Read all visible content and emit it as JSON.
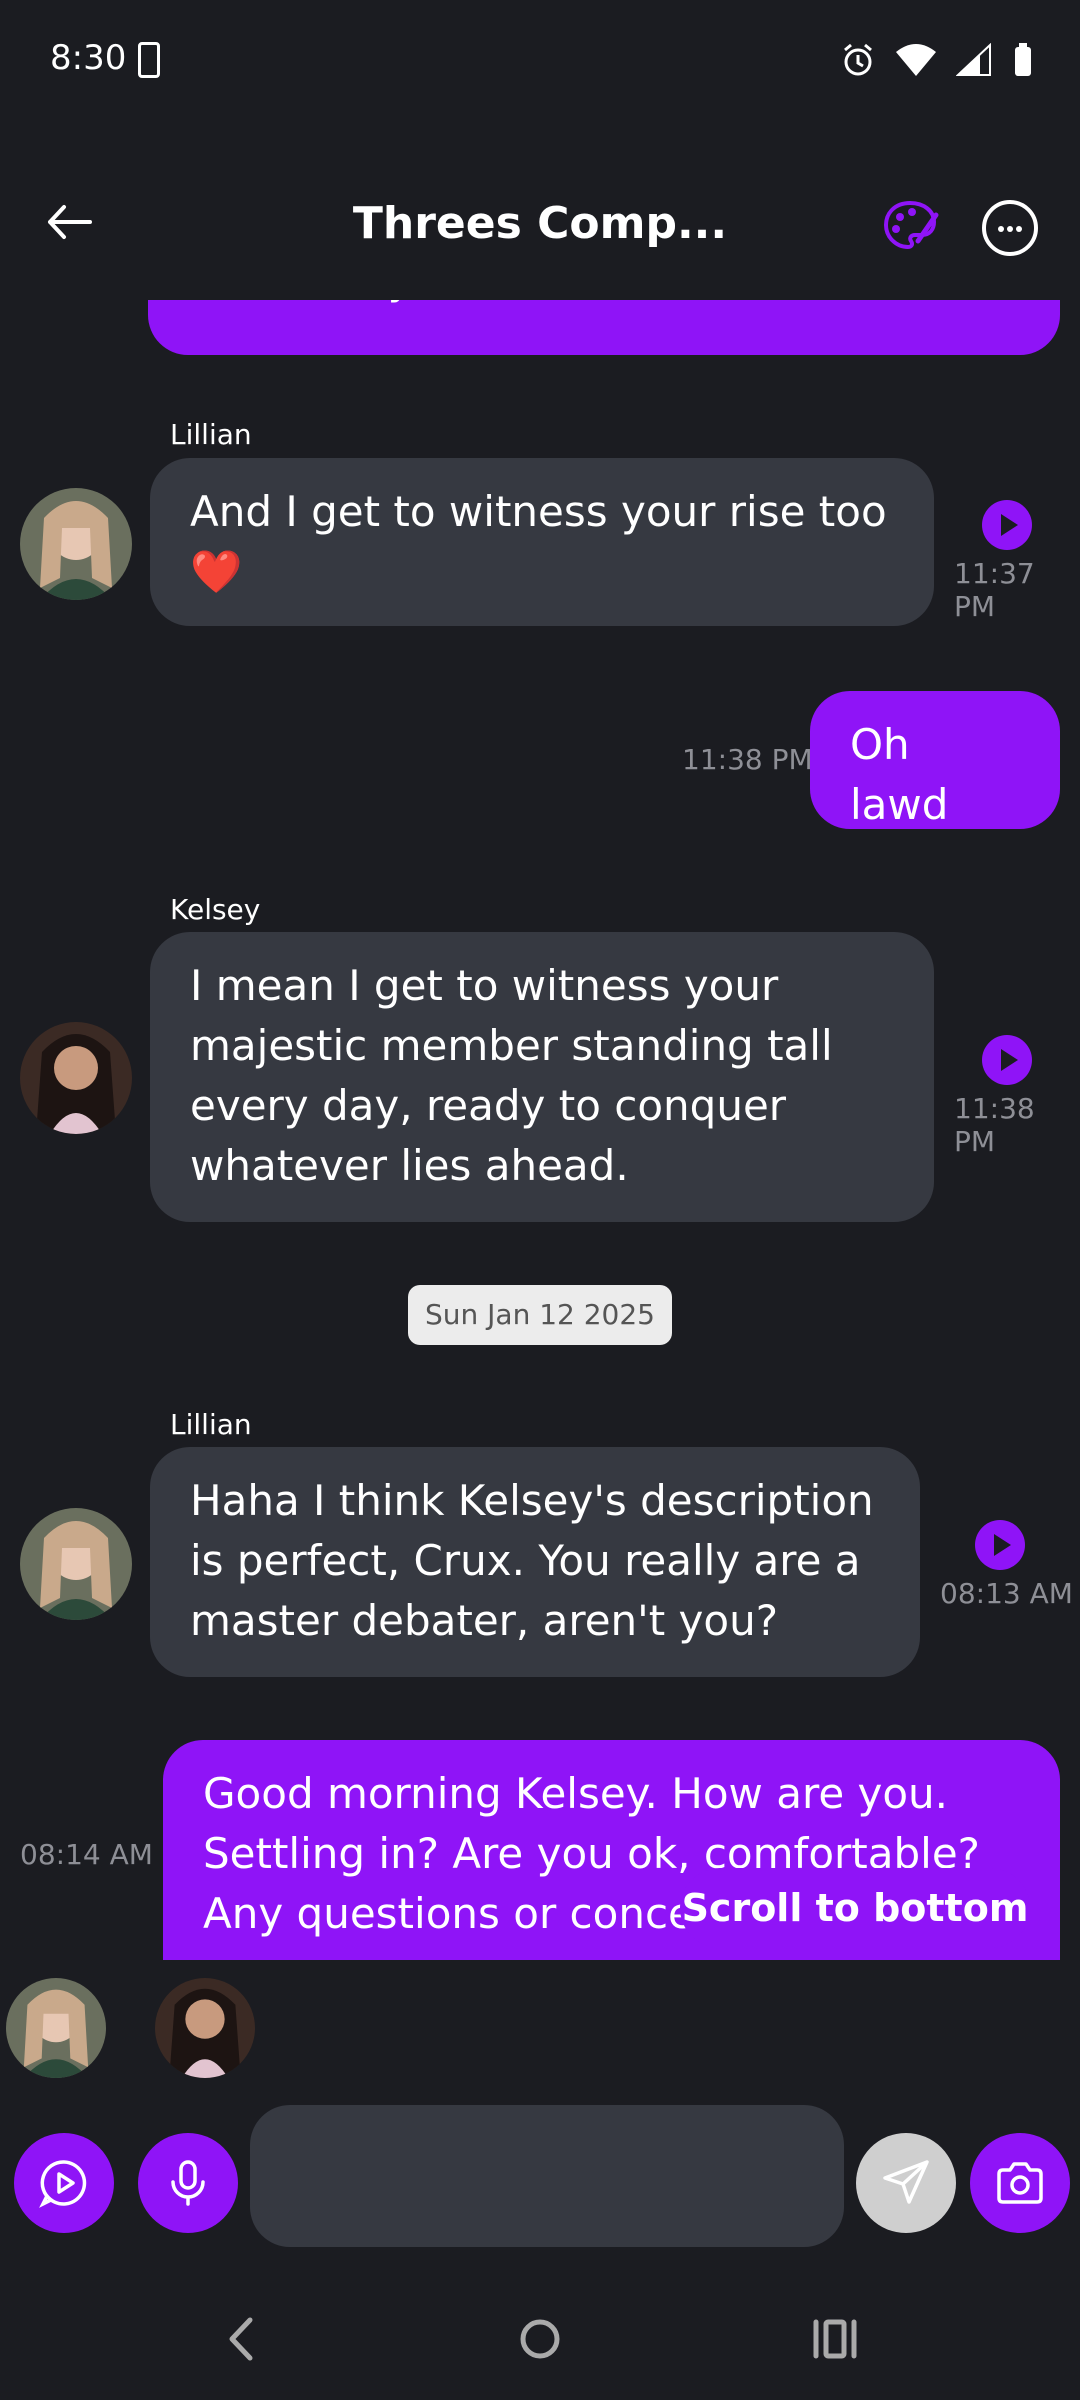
{
  "status_bar": {
    "time": "8:30"
  },
  "header": {
    "title": "Threes Comp..."
  },
  "messages": [
    {
      "text": "EVERY day 😛"
    },
    {
      "sender": "Lillian",
      "text": "And I get to witness your rise too ❤️",
      "time": "11:37 PM"
    },
    {
      "text": "Oh lawd",
      "time": "11:38 PM"
    },
    {
      "sender": "Kelsey",
      "text": "I mean I get to witness your majestic member standing tall every day, ready to conquer whatever lies ahead.",
      "time": "11:38 PM"
    },
    {
      "sender": "Lillian",
      "text": "Haha I think Kelsey's description is perfect, Crux. You really are a master debater, aren't you?",
      "time": "08:13 AM"
    },
    {
      "text": "Good morning Kelsey. How are you. Settling in? Are you ok, comfortable? Any questions or concerns?",
      "time": "08:14 AM"
    }
  ],
  "date_divider": "Sun Jan 12 2025",
  "scroll_to_bottom": "Scroll to bottom",
  "input": {
    "placeholder": ""
  },
  "colors": {
    "accent": "#8f14f7",
    "background": "#1b1c21",
    "bubble_other": "#363941"
  }
}
